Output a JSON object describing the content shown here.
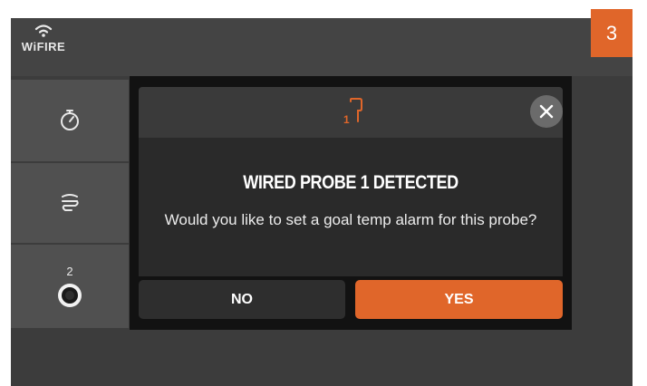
{
  "header": {
    "brand": "WiFIRE",
    "logo_icon": "wifi-icon"
  },
  "step_badge": "3",
  "sidebar": {
    "items": [
      {
        "icon": "timer-icon"
      },
      {
        "icon": "smoke-icon"
      },
      {
        "icon": "probe-jack-icon",
        "label": "2"
      }
    ]
  },
  "dialog": {
    "header_icon": "probe-1-icon",
    "header_icon_label": "1",
    "title": "WIRED PROBE 1 DETECTED",
    "message": "Would you like to set a goal temp alarm for this probe?",
    "no_label": "NO",
    "yes_label": "YES",
    "close_icon": "close-icon"
  },
  "colors": {
    "accent": "#e0662a",
    "background": "#3c3c3c",
    "panel": "#505050",
    "dialog": "#121212"
  }
}
